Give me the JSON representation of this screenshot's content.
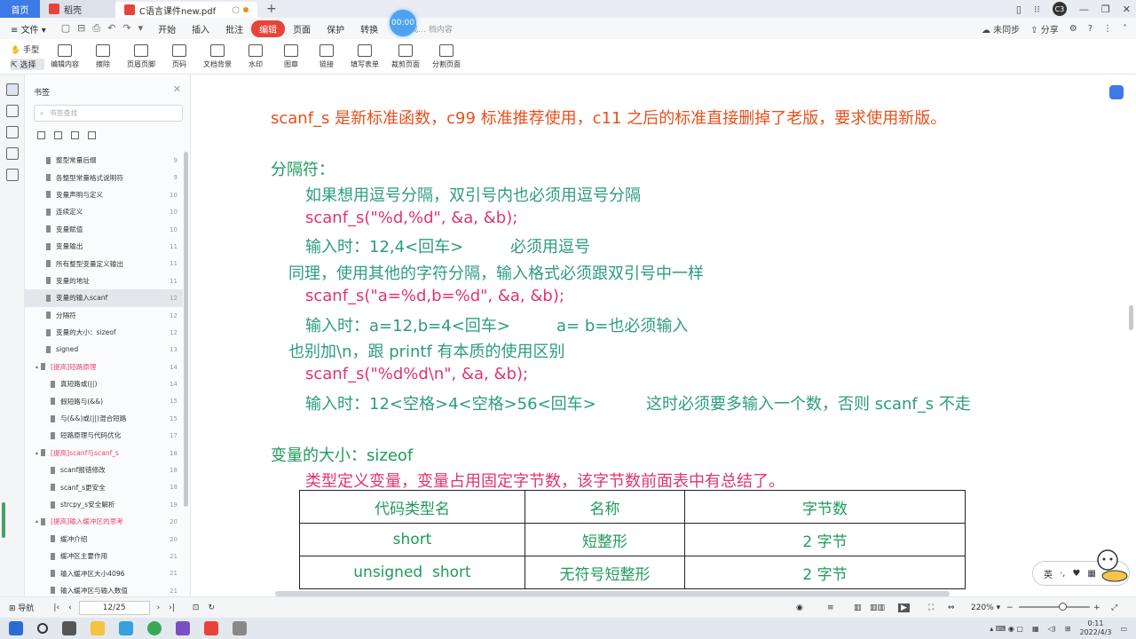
{
  "tabs": {
    "home": "首页",
    "shell": "稻壳",
    "doc": "C语言课件new.pdf",
    "new_tab": "+"
  },
  "window": {
    "avatar": "C3"
  },
  "menu": {
    "file": "文件",
    "items": [
      "开始",
      "插入",
      "批注",
      "编辑",
      "页面",
      "保护",
      "转换"
    ],
    "active_index": 3,
    "search": "查找…   档内容",
    "timer": "00:00",
    "right": [
      "未同步",
      "分享"
    ]
  },
  "toolbar": {
    "hand": "手型",
    "select": "选择",
    "tools": [
      "编辑内容",
      "擦除",
      "页眉页脚",
      "页码",
      "文档背景",
      "水印",
      "图章",
      "链接",
      "填写表单",
      "裁剪页面",
      "分割页面"
    ]
  },
  "panel": {
    "title": "书签",
    "search_placeholder": "书签查找",
    "items": [
      {
        "label": "整型常量后缀",
        "page": "9",
        "level": 1
      },
      {
        "label": "各整型常量格式说明符",
        "page": "9",
        "level": 1
      },
      {
        "label": "变量声明与定义",
        "page": "10",
        "level": 1
      },
      {
        "label": "连续定义",
        "page": "10",
        "level": 1
      },
      {
        "label": "变量赋值",
        "page": "10",
        "level": 1
      },
      {
        "label": "变量输出",
        "page": "11",
        "level": 1
      },
      {
        "label": "所有整型变量定义输出",
        "page": "11",
        "level": 1
      },
      {
        "label": "变量的地址",
        "page": "11",
        "level": 1
      },
      {
        "label": "变量的输入scanf",
        "page": "12",
        "level": 1,
        "selected": true
      },
      {
        "label": "分隔符",
        "page": "12",
        "level": 1
      },
      {
        "label": "变量的大小：sizeof",
        "page": "12",
        "level": 1
      },
      {
        "label": "signed",
        "page": "13",
        "level": 1
      },
      {
        "label": "[提高]短路原理",
        "page": "14",
        "level": 0
      },
      {
        "label": "真短路或(||)",
        "page": "14",
        "level": 2
      },
      {
        "label": "假短路与(&&)",
        "page": "15",
        "level": 2
      },
      {
        "label": "与(&&)或(||)混合短路",
        "page": "15",
        "level": 2
      },
      {
        "label": "短路原理与代码优化",
        "page": "17",
        "level": 2
      },
      {
        "label": "[提高]scanf与scanf_s",
        "page": "18",
        "level": 0
      },
      {
        "label": "scanf报错修改",
        "page": "18",
        "level": 2
      },
      {
        "label": "scanf_s更安全",
        "page": "18",
        "level": 2
      },
      {
        "label": "strcpy_s安全解析",
        "page": "19",
        "level": 2
      },
      {
        "label": "[提高]输入缓冲区的思考",
        "page": "20",
        "level": 0
      },
      {
        "label": "缓冲介绍",
        "page": "20",
        "level": 2
      },
      {
        "label": "缓冲区主要作用",
        "page": "21",
        "level": 2
      },
      {
        "label": "输入缓冲区大小4096",
        "page": "21",
        "level": 2
      },
      {
        "label": "输入缓冲区与输入数值",
        "page": "21",
        "level": 2
      }
    ]
  },
  "document": {
    "intro": "scanf_s 是新标准函数，c99 标准推荐使用，c11 之后的标准直接删掉了老版，要求使用新版。",
    "separator_title": "分隔符：",
    "sep_line1": "如果想用逗号分隔，双引号内也必须用逗号分隔",
    "sep_code1": "scanf_s(\"%d,%d\", &a, &b);",
    "sep_input1": "输入时：12,4<回车>",
    "sep_note1": "必须用逗号",
    "sep_line2": "同理，使用其他的字符分隔，输入格式必须跟双引号中一样",
    "sep_code2": "scanf_s(\"a=%d,b=%d\", &a, &b);",
    "sep_input2": "输入时：a=12,b=4<回车>",
    "sep_note2": "a= b=也必须输入",
    "sep_line3": "也别加\\n，跟 printf 有本质的使用区别",
    "sep_code3": "scanf_s(\"%d%d\\n\", &a, &b);",
    "sep_input3": "输入时：12<空格>4<空格>56<回车>",
    "sep_note3": "这时必须要多输入一个数，否则 scanf_s 不走",
    "sizeof_title": "变量的大小：sizeof",
    "sizeof_desc": "类型定义变量，变量占用固定字节数，该字节数前面表中有总结了。",
    "table": {
      "headers": [
        "代码类型名",
        "名称",
        "字节数"
      ],
      "rows": [
        [
          "short",
          "短整形",
          "2 字节"
        ],
        [
          "unsigned  short",
          "无符号短整形",
          "2 字节"
        ]
      ]
    }
  },
  "ime": {
    "lang": "英",
    "extra": "·,"
  },
  "status": {
    "nav": "导航",
    "page": "12/25",
    "zoom": "220%"
  },
  "tray": {
    "time": "0:11",
    "date": "2022/4/3"
  },
  "colors": {
    "accent": "#3d7ae6",
    "active_menu": "#e8433b",
    "doc_orange": "#e8501c",
    "doc_green": "#1f9b5b",
    "doc_pink": "#e0356b",
    "bookmark_heading": "#e8476b"
  }
}
